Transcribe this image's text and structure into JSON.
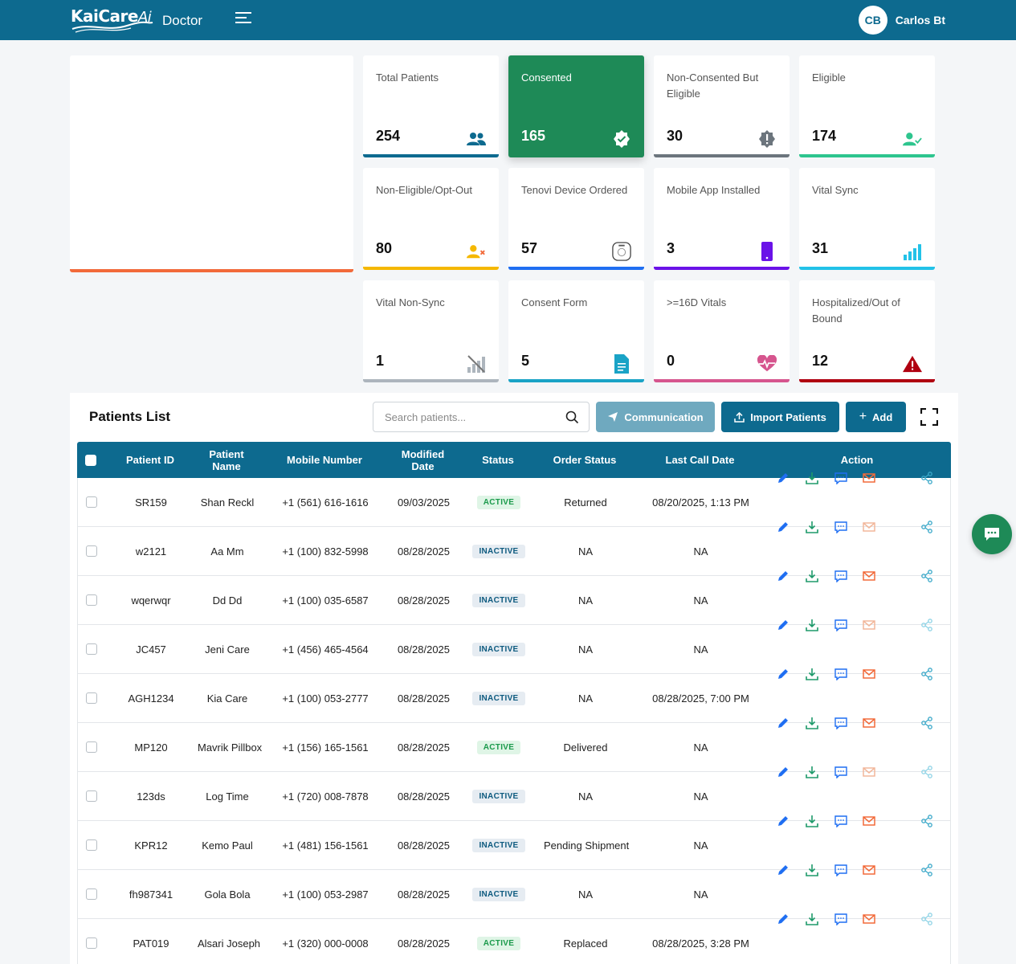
{
  "app": {
    "logo": "KaiCare",
    "logo_suffix": "Ai",
    "role": "Doctor"
  },
  "user": {
    "initials": "CB",
    "name": "Carlos Bt"
  },
  "colors": {
    "brand": "#0d6a8f",
    "consented": "#1e8a57",
    "chart_border": "#f26a3a"
  },
  "stats": [
    {
      "label": "Total Patients",
      "value": "254",
      "icon": "users-icon",
      "color": "#0d6a8f"
    },
    {
      "label": "Consented",
      "value": "165",
      "icon": "verified-badge-icon",
      "color": "#1e8a57"
    },
    {
      "label": "Non-Consented But Eligible",
      "value": "30",
      "icon": "exclamation-badge-icon",
      "color": "#6c757d"
    },
    {
      "label": "Eligible",
      "value": "174",
      "icon": "user-check-icon",
      "color": "#2ec58e"
    },
    {
      "label": "Non-Eligible/Opt-Out",
      "value": "80",
      "icon": "user-x-icon",
      "color": "#f5b800"
    },
    {
      "label": "Tenovi Device Ordered",
      "value": "57",
      "icon": "device-icon",
      "color": "#1f6ef2"
    },
    {
      "label": "Mobile App Installed",
      "value": "3",
      "icon": "mobile-icon",
      "color": "#6a12e8"
    },
    {
      "label": "Vital Sync",
      "value": "31",
      "icon": "signal-bars-icon",
      "color": "#22c2e8"
    },
    {
      "label": "Vital Non-Sync",
      "value": "1",
      "icon": "signal-off-icon",
      "color": "#adb5bd"
    },
    {
      "label": "Consent Form",
      "value": "5",
      "icon": "document-icon",
      "color": "#1aa3c6"
    },
    {
      "label": ">=16D Vitals",
      "value": "0",
      "icon": "heart-pulse-icon",
      "color": "#d6558e"
    },
    {
      "label": "Hospitalized/Out of Bound",
      "value": "12",
      "icon": "warning-icon",
      "color": "#b00010"
    }
  ],
  "patients_list": {
    "title": "Patients List",
    "search_placeholder": "Search patients...",
    "buttons": {
      "communication": "Communication",
      "import": "Import Patients",
      "add": "Add"
    },
    "columns": [
      "Patient ID",
      "Patient Name",
      "Mobile Number",
      "Modified Date",
      "Status",
      "Order Status",
      "Last Call Date",
      "Action"
    ],
    "rows": [
      {
        "id": "SR159",
        "name": "Shan Reckl",
        "mobile": "+1 (561) 616-1616",
        "modified": "09/03/2025",
        "status": "ACTIVE",
        "order": "Returned",
        "last_call": "08/20/2025, 1:13 PM"
      },
      {
        "id": "w2121",
        "name": "Aa Mm",
        "mobile": "+1 (100) 832-5998",
        "modified": "08/28/2025",
        "status": "INACTIVE",
        "order": "NA",
        "last_call": "NA"
      },
      {
        "id": "wqerwqr",
        "name": "Dd Dd",
        "mobile": "+1 (100) 035-6587",
        "modified": "08/28/2025",
        "status": "INACTIVE",
        "order": "NA",
        "last_call": "NA"
      },
      {
        "id": "JC457",
        "name": "Jeni Care",
        "mobile": "+1 (456) 465-4564",
        "modified": "08/28/2025",
        "status": "INACTIVE",
        "order": "NA",
        "last_call": "NA"
      },
      {
        "id": "AGH1234",
        "name": "Kia Care",
        "mobile": "+1 (100) 053-2777",
        "modified": "08/28/2025",
        "status": "INACTIVE",
        "order": "NA",
        "last_call": "08/28/2025, 7:00 PM"
      },
      {
        "id": "MP120",
        "name": "Mavrik Pillbox",
        "mobile": "+1 (156) 165-1561",
        "modified": "08/28/2025",
        "status": "ACTIVE",
        "order": "Delivered",
        "last_call": "NA"
      },
      {
        "id": "123ds",
        "name": "Log Time",
        "mobile": "+1 (720) 008-7878",
        "modified": "08/28/2025",
        "status": "INACTIVE",
        "order": "NA",
        "last_call": "NA"
      },
      {
        "id": "KPR12",
        "name": "Kemo Paul",
        "mobile": "+1 (481) 156-1561",
        "modified": "08/28/2025",
        "status": "INACTIVE",
        "order": "Pending Shipment",
        "last_call": "NA"
      },
      {
        "id": "fh987341",
        "name": "Gola Bola",
        "mobile": "+1 (100) 053-2987",
        "modified": "08/28/2025",
        "status": "INACTIVE",
        "order": "NA",
        "last_call": "NA"
      },
      {
        "id": "PAT019",
        "name": "Alsari Joseph",
        "mobile": "+1 (320) 000-0008",
        "modified": "08/28/2025",
        "status": "ACTIVE",
        "order": "Replaced",
        "last_call": "08/28/2025, 3:28 PM"
      }
    ]
  }
}
